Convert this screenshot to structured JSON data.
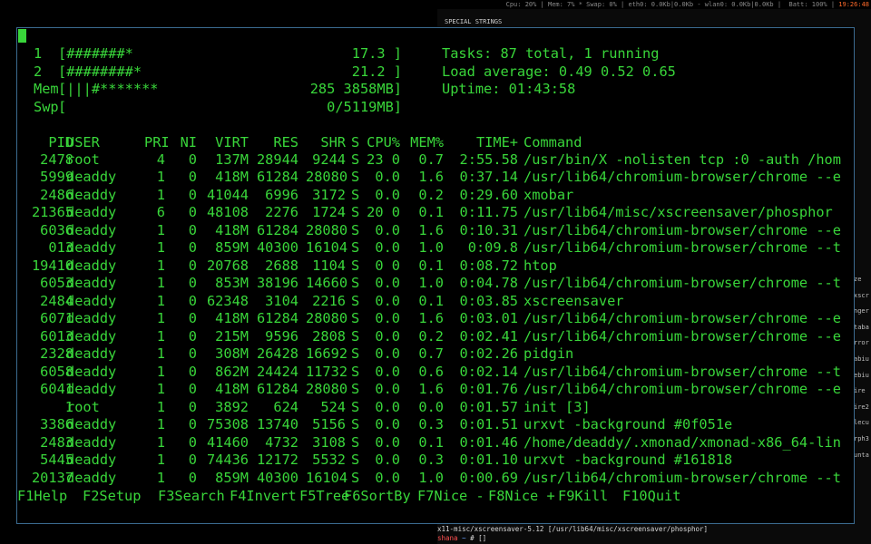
{
  "xmobar": {
    "status": "Cpu: 20% | Mem: 7% * Swap: 0% | eth0: 0.0Kb|0.0Kb - wlan0: 0.0Kb|0.0Kb |  Batt: 100% | ",
    "clock": "19:26:48"
  },
  "background_window": {
    "header": "SPECIAL STRINGS",
    "side_fragments": [
      "ze",
      "xscr",
      "nger",
      "taba",
      "rror",
      "abiu",
      "ebiu",
      "ire",
      "ire2",
      "lecu",
      "rph3",
      "unta"
    ],
    "command_line": "x11-misc/xscreensaver-5.12 [/usr/lib64/misc/xscreensaver/phosphor]",
    "prompt_user": "shana",
    "prompt_path": "~",
    "prompt_symbol": "# []"
  },
  "meters": {
    "cpu1": {
      "label": "1",
      "bar": "[#######*",
      "value": "17.3 ]"
    },
    "cpu2": {
      "label": "2",
      "bar": "[########*",
      "value": "21.2 ]"
    },
    "mem": {
      "label": "Mem",
      "bar": "[|||#*******",
      "value": "285 3858MB]"
    },
    "swp": {
      "label": "Swp",
      "bar": "[",
      "value": "0/5119MB]"
    }
  },
  "summary": {
    "tasks": "Tasks: 87 total, 1 running",
    "load": "Load average: 0.49 0.52 0.65",
    "uptime": "Uptime: 01:43:58"
  },
  "columns": [
    "PID",
    "USER",
    "PRI",
    "NI",
    "VIRT",
    "RES",
    "SHR",
    "S",
    "CPU%",
    "MEM%",
    "TIME+",
    "Command"
  ],
  "processes": [
    [
      "2478",
      "root",
      "4",
      "0",
      "137M",
      "28944",
      "9244",
      "S",
      "23 0",
      "0.7",
      "2:55.58",
      "/usr/bin/X -nolisten tcp :0 -auth /hom"
    ],
    [
      "5999",
      "deaddy",
      "1",
      "0",
      "418M",
      "61284",
      "28080",
      "S",
      "0.0",
      "1.6",
      "0:37.14",
      "/usr/lib64/chromium-browser/chrome --e"
    ],
    [
      "2486",
      "deaddy",
      "1",
      "0",
      "41044",
      "6996",
      "3172",
      "S",
      "0.0",
      "0.2",
      "0:29.60",
      "xmobar"
    ],
    [
      "21365",
      "deaddy",
      "6",
      "0",
      "48108",
      "2276",
      "1724",
      "S",
      "20 0",
      "0.1",
      "0:11.75",
      "/usr/lib64/misc/xscreensaver/phosphor"
    ],
    [
      "6036",
      "deaddy",
      "1",
      "0",
      "418M",
      "61284",
      "28080",
      "S",
      "0.0",
      "1.6",
      "0:10.31",
      "/usr/lib64/chromium-browser/chrome --e"
    ],
    [
      "013",
      "deaddy",
      "1",
      "0",
      "859M",
      "40300",
      "16104",
      "S",
      "0.0",
      "1.0",
      "0:09.8",
      "/usr/lib64/chromium-browser/chrome --t"
    ],
    [
      "19410",
      "deaddy",
      "1",
      "0",
      "20768",
      "2688",
      "1104",
      "S",
      "0 0",
      "0.1",
      "0:08.72",
      "htop"
    ],
    [
      "6053",
      "deaddy",
      "1",
      "0",
      "853M",
      "38196",
      "14660",
      "S",
      "0.0",
      "1.0",
      "0:04.78",
      "/usr/lib64/chromium-browser/chrome --t"
    ],
    [
      "2484",
      "deaddy",
      "1",
      "0",
      "62348",
      "3104",
      "2216",
      "S",
      "0.0",
      "0.1",
      "0:03.85",
      "xscreensaver"
    ],
    [
      "6071",
      "deaddy",
      "1",
      "0",
      "418M",
      "61284",
      "28080",
      "S",
      "0.0",
      "1.6",
      "0:03.01",
      "/usr/lib64/chromium-browser/chrome --e"
    ],
    [
      "6013",
      "deaddy",
      "1",
      "0",
      "215M",
      "9596",
      "2808",
      "S",
      "0.0",
      "0.2",
      "0:02.41",
      "/usr/lib64/chromium-browser/chrome --e"
    ],
    [
      "2328",
      "deaddy",
      "1",
      "0",
      "308M",
      "26428",
      "16692",
      "S",
      "0.0",
      "0.7",
      "0:02.26",
      "pidgin"
    ],
    [
      "6058",
      "deaddy",
      "1",
      "0",
      "862M",
      "24424",
      "11732",
      "S",
      "0.0",
      "0.6",
      "0:02.14",
      "/usr/lib64/chromium-browser/chrome --t"
    ],
    [
      "6041",
      "deaddy",
      "1",
      "0",
      "418M",
      "61284",
      "28080",
      "S",
      "0.0",
      "1.6",
      "0:01.76",
      "/usr/lib64/chromium-browser/chrome --e"
    ],
    [
      "1",
      "root",
      "1",
      "0",
      "3892",
      "624",
      "524",
      "S",
      "0.0",
      "0.0",
      "0:01.57",
      "init [3]"
    ],
    [
      "3386",
      "deaddy",
      "1",
      "0",
      "75308",
      "13740",
      "5156",
      "S",
      "0.0",
      "0.3",
      "0:01.51",
      "urxvt -background #0f051e"
    ],
    [
      "2483",
      "deaddy",
      "1",
      "0",
      "41460",
      "4732",
      "3108",
      "S",
      "0.0",
      "0.1",
      "0:01.46",
      "/home/deaddy/.xmonad/xmonad-x86_64-lin"
    ],
    [
      "5445",
      "deaddy",
      "1",
      "0",
      "74436",
      "12172",
      "5532",
      "S",
      "0.0",
      "0.3",
      "0:01.10",
      "urxvt -background #161818"
    ],
    [
      "20137",
      "deaddy",
      "1",
      "0",
      "859M",
      "40300",
      "16104",
      "S",
      "0.0",
      "1.0",
      "0:00.69",
      "/usr/lib64/chromium-browser/chrome --t"
    ]
  ],
  "function_keys": [
    {
      "key": "F1",
      "label": "Help"
    },
    {
      "key": "F2",
      "label": "Setup"
    },
    {
      "key": "F3",
      "label": "Search"
    },
    {
      "key": "F4",
      "label": "Invert"
    },
    {
      "key": "F5",
      "label": "Tree"
    },
    {
      "key": "F6",
      "label": "SortBy"
    },
    {
      "key": "F7",
      "label": "Nice -"
    },
    {
      "key": "F8",
      "label": "Nice +"
    },
    {
      "key": "F9",
      "label": "Kill"
    },
    {
      "key": "F10",
      "label": "Quit"
    }
  ],
  "colors": {
    "terminal_text": "#39d63a",
    "terminal_border": "#3b6b90",
    "clock": "#ff6a2a"
  }
}
